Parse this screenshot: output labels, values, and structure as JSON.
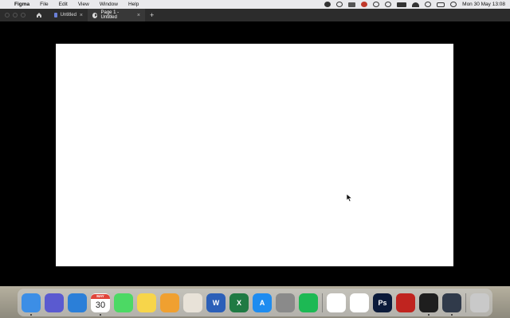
{
  "menubar": {
    "apple_icon": "apple-icon",
    "app_name": "Figma",
    "menus": [
      "File",
      "Edit",
      "View",
      "Window",
      "Help"
    ],
    "clock": "Mon 30 May  13:08"
  },
  "tabs": {
    "home_icon": "home-icon",
    "items": [
      {
        "label": "Untitled",
        "close": "×"
      },
      {
        "label": "Page 1 - Untitled",
        "close": "×"
      }
    ],
    "new_tab": "+"
  },
  "dock": {
    "items": [
      {
        "name": "finder",
        "color": "#3c8ee6"
      },
      {
        "name": "launchpad",
        "color": "#5a5ad0"
      },
      {
        "name": "safari",
        "color": "#2b7fd8"
      },
      {
        "name": "calendar",
        "month": "MAY",
        "day": "30"
      },
      {
        "name": "messages",
        "color": "#4cd964"
      },
      {
        "name": "notes",
        "color": "#f7d54a"
      },
      {
        "name": "photos",
        "color": "#f0a030"
      },
      {
        "name": "preview",
        "color": "#e8e2d8"
      },
      {
        "name": "word",
        "color": "#2b5fb8",
        "glyph": "W"
      },
      {
        "name": "excel",
        "color": "#1f7a43",
        "glyph": "X"
      },
      {
        "name": "app-store",
        "color": "#1e8cf0",
        "glyph": "A"
      },
      {
        "name": "system-preferences",
        "color": "#8a8a8a"
      },
      {
        "name": "spotify",
        "color": "#1db954"
      },
      {
        "name": "slack",
        "color": "#ffffff"
      },
      {
        "name": "asana",
        "color": "#ffffff"
      },
      {
        "name": "photoshop",
        "color": "#0b1a3a",
        "glyph": "Ps"
      },
      {
        "name": "acrobat",
        "color": "#c0241f"
      },
      {
        "name": "figma",
        "color": "#1e1e1e"
      },
      {
        "name": "quicktime",
        "color": "#303a4a"
      },
      {
        "name": "trash",
        "color": "#c9c9c9"
      }
    ]
  }
}
